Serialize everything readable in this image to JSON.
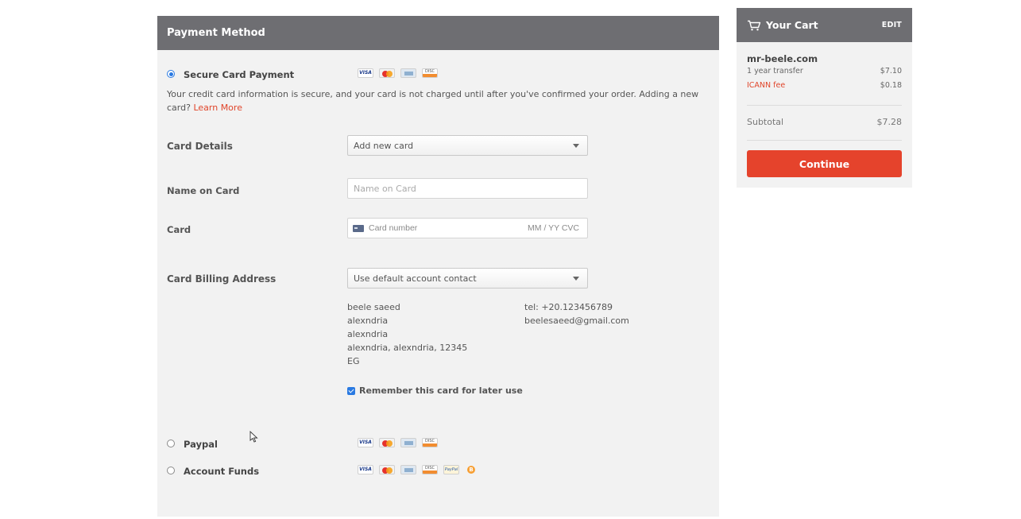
{
  "payment": {
    "header": "Payment Method",
    "secure_card": {
      "label": "Secure Card Payment",
      "selected": true,
      "info": "Your credit card information is secure, and your card is not charged until after you've confirmed your order. Adding a new card?",
      "learn_more": "Learn More"
    },
    "card_details": {
      "label": "Card Details",
      "selected_option": "Add new card"
    },
    "name_on_card": {
      "label": "Name on Card",
      "placeholder": "Name on Card"
    },
    "card": {
      "label": "Card",
      "number_placeholder": "Card number",
      "exp_cvc_placeholder": "MM / YY  CVC"
    },
    "billing_address": {
      "label": "Card Billing Address",
      "selected_option": "Use default account contact",
      "address_lines": [
        "beele saeed",
        "alexndria",
        "alexndria",
        "alexndria, alexndria, 12345",
        "EG"
      ],
      "contact_lines": [
        "tel: +20.123456789",
        "beelesaeed@gmail.com"
      ]
    },
    "remember": {
      "label": "Remember this card for later use",
      "checked": true
    },
    "paypal": {
      "label": "Paypal",
      "selected": false
    },
    "account_funds": {
      "label": "Account Funds",
      "selected": false
    }
  },
  "cart": {
    "title": "Your Cart",
    "edit": "EDIT",
    "domain": "mr-beele.com",
    "items": [
      {
        "label": "1 year transfer",
        "price": "$7.10"
      },
      {
        "label": "ICANN fee",
        "price": "$0.18"
      }
    ],
    "subtotal_label": "Subtotal",
    "subtotal_value": "$7.28",
    "continue_label": "Continue"
  },
  "colors": {
    "header_bg": "#6e6e72",
    "panel_bg": "#f2f2f2",
    "accent_red": "#e5432c",
    "link_red": "#e0452a",
    "radio_blue": "#2a7ae2"
  }
}
